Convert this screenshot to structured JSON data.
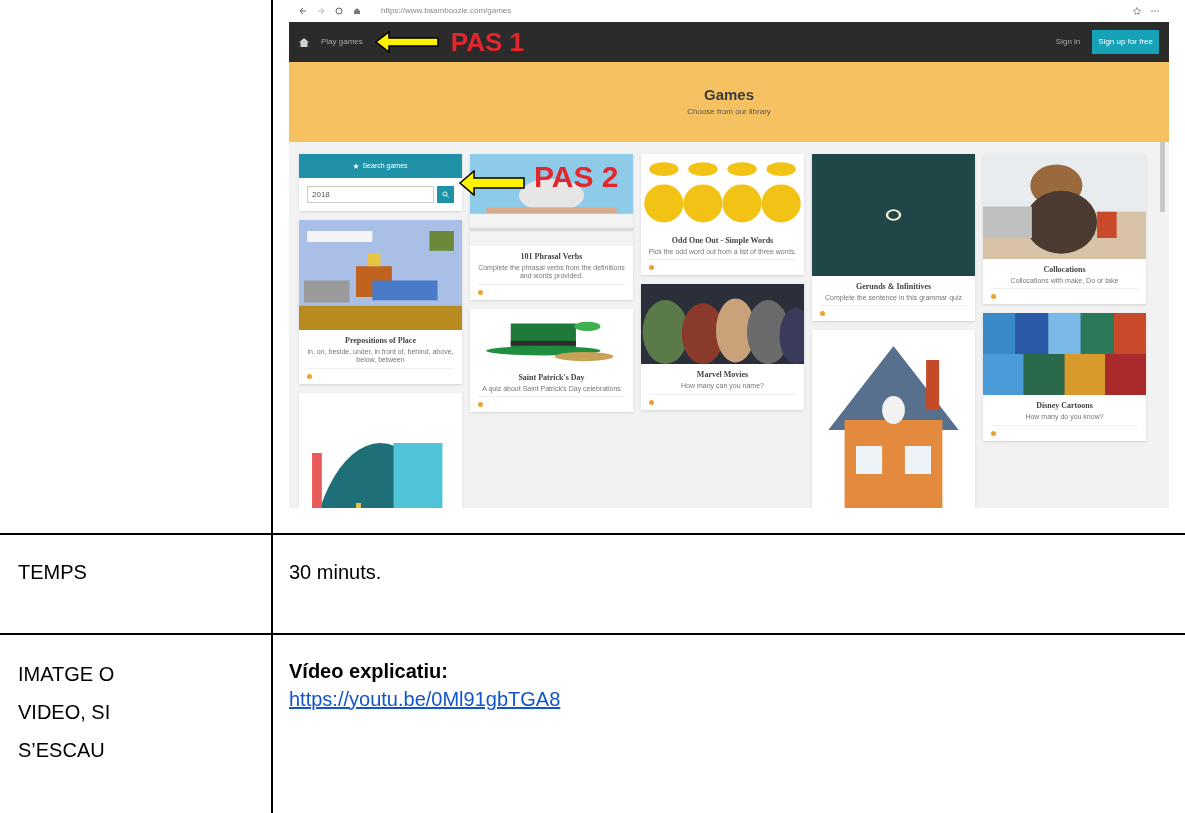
{
  "screenshot": {
    "browser": {
      "url": "https://www.baamboozle.com/games"
    },
    "nav": {
      "play_games": "Play games",
      "sign_in": "Sign in",
      "sign_up": "Sign up for free"
    },
    "banner": {
      "title": "Games",
      "subtitle": "Choose from our library"
    },
    "annotations": [
      {
        "text": "PAS 1"
      },
      {
        "text": "PAS 2"
      }
    ],
    "columns": [
      [
        {
          "kind": "search",
          "title": "Search games",
          "value": "2018"
        },
        {
          "kind": "game",
          "title": "Prepositions of Place",
          "description": "in, on, beside, under, in front of, behind, above, below, between"
        },
        {
          "kind": "picture"
        }
      ],
      [
        {
          "kind": "game",
          "title": "101 Phrasal Verbs",
          "description": "Complete the phrasal verbs from the definitions and words provided."
        },
        {
          "kind": "game",
          "title": "Saint Patrick's Day",
          "description": "A quiz about Saint Patrick's Day celebrations"
        }
      ],
      [
        {
          "kind": "game",
          "title": "Odd One Out - Simple Words",
          "description": "Pick the odd word out from a list of three words."
        },
        {
          "kind": "game",
          "title": "Marvel Movies",
          "description": "How many can you name?"
        }
      ],
      [
        {
          "kind": "game",
          "title": "Gerunds & Infinitives",
          "description": "Complete the sentence in this grammar quiz"
        },
        {
          "kind": "picture"
        }
      ],
      [
        {
          "kind": "game",
          "title": "Collocations",
          "description": "Collocations with make, Do or take"
        },
        {
          "kind": "game",
          "title": "Disney Cartoons",
          "description": "How many do you know?"
        }
      ]
    ]
  },
  "rows": [
    {
      "label": "TEMPS",
      "value": "30 minuts."
    },
    {
      "label": "IMATGE O VIDEO, SI S’ESCAU",
      "heading": "Vídeo explicatiu:",
      "link": "https://youtu.be/0Ml91gbTGA8"
    }
  ]
}
